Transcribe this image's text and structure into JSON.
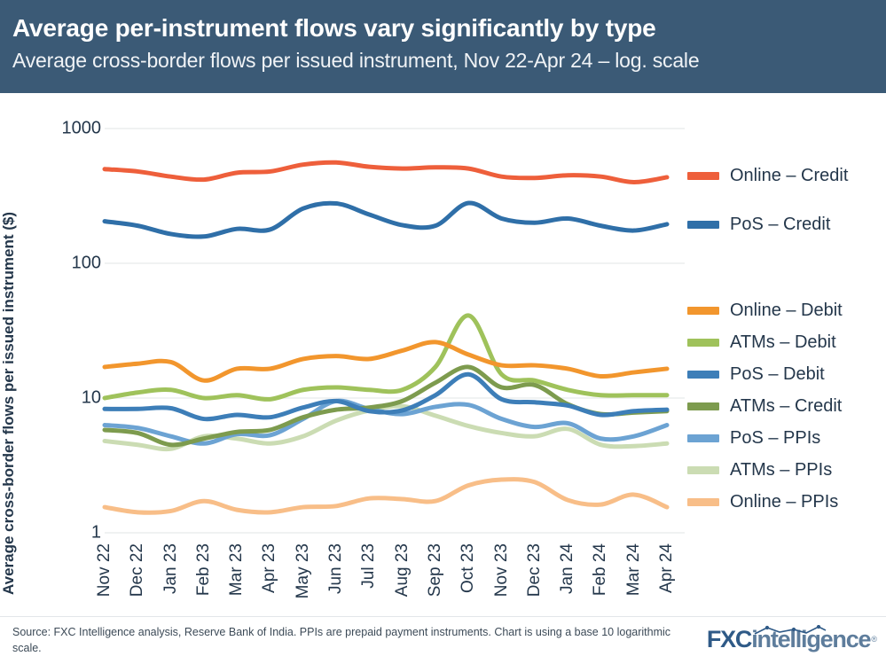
{
  "header": {
    "title": "Average per-instrument flows vary significantly by type",
    "subtitle": "Average cross-border flows per issued instrument, Nov 22-Apr 24 – log. scale",
    "background_color": "#3B5A76"
  },
  "footer": {
    "source": "Source: FXC Intelligence analysis, Reserve Bank of India. PPIs are prepaid payment instruments. Chart is using a base 10 logarithmic scale.",
    "logo_primary": "FXC",
    "logo_secondary": "intelligence",
    "logo_trademark": "®"
  },
  "axis": {
    "y_title": "Average cross-border flows per issued instrument ($)",
    "y_ticks": [
      "1000",
      "100",
      "10",
      "1"
    ],
    "x_ticks": [
      "Nov 22",
      "Dec 22",
      "Jan 23",
      "Feb 23",
      "Mar 23",
      "Apr 23",
      "May 23",
      "Jun 23",
      "Jul 23",
      "Aug 23",
      "Sep 23",
      "Oct 23",
      "Nov 23",
      "Dec 23",
      "Jan 24",
      "Feb 24",
      "Mar 24",
      "Apr 24"
    ]
  },
  "legend": {
    "items": [
      {
        "label": "Online – Credit",
        "color": "#EE5F3B",
        "top": 82
      },
      {
        "label": "PoS – Credit",
        "color": "#2F6FA8",
        "top": 137
      },
      {
        "label": "Online – Debit",
        "color": "#F2962D",
        "top": 234
      },
      {
        "label": "ATMs – Debit",
        "color": "#9FC25B",
        "top": 270
      },
      {
        "label": "PoS – Debit",
        "color": "#3D7EB8",
        "top": 306
      },
      {
        "label": "ATMs – Credit",
        "color": "#7D9B4E",
        "top": 342
      },
      {
        "label": "PoS – PPIs",
        "color": "#6CA3D3",
        "top": 378
      },
      {
        "label": "ATMs – PPIs",
        "color": "#CBDCB3",
        "top": 414
      },
      {
        "label": "Online – PPIs",
        "color": "#F8BE88",
        "top": 450
      }
    ]
  },
  "chart_data": {
    "type": "line",
    "title": "Average per-instrument flows vary significantly by type",
    "subtitle": "Average cross-border flows per issued instrument, Nov 22-Apr 24 – log. scale",
    "xlabel": "",
    "ylabel": "Average cross-border flows per issued instrument ($)",
    "yscale": "log10",
    "ylim": [
      1,
      1000
    ],
    "y_gridlines": [
      1,
      10,
      100,
      1000
    ],
    "grid": true,
    "legend_position": "right",
    "x": [
      "Nov 22",
      "Dec 22",
      "Jan 23",
      "Feb 23",
      "Mar 23",
      "Apr 23",
      "May 23",
      "Jun 23",
      "Jul 23",
      "Aug 23",
      "Sep 23",
      "Oct 23",
      "Nov 23",
      "Dec 23",
      "Jan 24",
      "Feb 24",
      "Mar 24",
      "Apr 24"
    ],
    "series": [
      {
        "name": "Online – Credit",
        "color": "#EE5F3B",
        "values": [
          500,
          480,
          440,
          418,
          470,
          480,
          540,
          560,
          520,
          505,
          515,
          505,
          440,
          430,
          450,
          440,
          400,
          435,
          460
        ]
      },
      {
        "name": "PoS – Credit",
        "color": "#2F6FA8",
        "values": [
          205,
          190,
          165,
          158,
          180,
          178,
          255,
          278,
          230,
          192,
          190,
          280,
          215,
          200,
          215,
          190,
          175,
          195,
          200
        ]
      },
      {
        "name": "Online – Debit",
        "color": "#F2962D",
        "values": [
          17,
          18,
          18.5,
          13.5,
          16.5,
          16.5,
          19.5,
          20.5,
          19.5,
          22.5,
          26,
          21,
          17.5,
          17.5,
          16.5,
          14.5,
          15.5,
          16.5,
          16.5
        ]
      },
      {
        "name": "ATMs – Debit",
        "color": "#9FC25B",
        "values": [
          10,
          11,
          11.5,
          10,
          10.5,
          9.8,
          11.5,
          12,
          11.5,
          11.5,
          17,
          41,
          15,
          13.5,
          11.5,
          10.5,
          10.5,
          10.5,
          10.5
        ]
      },
      {
        "name": "PoS – Debit",
        "color": "#3D7EB8",
        "values": [
          8.3,
          8.3,
          8.4,
          7.0,
          7.5,
          7.2,
          8.5,
          9.5,
          8.0,
          8.1,
          10.5,
          15,
          9.8,
          9.3,
          8.8,
          7.5,
          8.0,
          8.2,
          8.4
        ]
      },
      {
        "name": "ATMs – Credit",
        "color": "#7D9B4E",
        "values": [
          5.8,
          5.5,
          4.5,
          5.0,
          5.6,
          5.8,
          7.2,
          8.2,
          8.5,
          9.5,
          13,
          17,
          12,
          12.5,
          9.0,
          7.6,
          7.8,
          8.0,
          8.1
        ]
      },
      {
        "name": "PoS – PPIs",
        "color": "#6CA3D3",
        "values": [
          6.3,
          6.0,
          5.2,
          4.6,
          5.4,
          5.3,
          7.0,
          9.5,
          8.3,
          7.6,
          8.6,
          8.9,
          7.0,
          6.1,
          6.5,
          5.0,
          5.2,
          6.3,
          7.2
        ]
      },
      {
        "name": "ATMs – PPIs",
        "color": "#CBDCB3",
        "values": [
          4.8,
          4.5,
          4.2,
          5.2,
          5.0,
          4.6,
          5.2,
          6.8,
          8.1,
          8.7,
          7.4,
          6.2,
          5.5,
          5.2,
          5.9,
          4.5,
          4.4,
          4.6,
          4.4
        ]
      },
      {
        "name": "Online – PPIs",
        "color": "#F8BE88",
        "values": [
          1.55,
          1.42,
          1.45,
          1.72,
          1.48,
          1.42,
          1.55,
          1.58,
          1.8,
          1.78,
          1.72,
          2.25,
          2.48,
          2.38,
          1.75,
          1.62,
          1.92,
          1.55,
          1.6,
          1.78
        ]
      }
    ]
  }
}
